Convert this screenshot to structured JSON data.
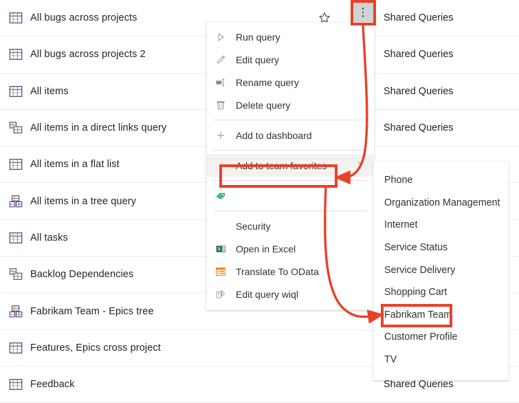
{
  "app": {
    "accent_red": "#e8412a",
    "highlight_bg": "#f3f2f1",
    "ellipsis_bg": "#d2d2d2"
  },
  "query_list": {
    "folder_label": "Shared Queries",
    "rows": [
      {
        "name": "All bugs across projects",
        "icon": "flat-query-icon",
        "folder": "Shared Queries",
        "has_star": true,
        "has_ellipsis": true
      },
      {
        "name": "All bugs across projects 2",
        "icon": "flat-query-icon",
        "folder": "Shared Queries",
        "has_star": false,
        "has_ellipsis": false
      },
      {
        "name": "All items",
        "icon": "flat-query-icon",
        "folder": "Shared Queries",
        "has_star": false,
        "has_ellipsis": false
      },
      {
        "name": "All items in a direct links query",
        "icon": "direct-links-query-icon",
        "folder": "Shared Queries",
        "has_star": false,
        "has_ellipsis": false
      },
      {
        "name": "All items in a flat list",
        "icon": "flat-query-icon",
        "folder": "",
        "has_star": false,
        "has_ellipsis": false
      },
      {
        "name": "All items in a tree query",
        "icon": "tree-query-icon",
        "folder": "",
        "has_star": false,
        "has_ellipsis": false
      },
      {
        "name": "All tasks",
        "icon": "flat-query-icon",
        "folder": "",
        "has_star": false,
        "has_ellipsis": false
      },
      {
        "name": "Backlog Dependencies",
        "icon": "direct-links-query-icon",
        "folder": "",
        "has_star": false,
        "has_ellipsis": false
      },
      {
        "name": "Fabrikam Team - Epics tree",
        "icon": "tree-query-icon",
        "folder": "",
        "has_star": false,
        "has_ellipsis": false
      },
      {
        "name": "Features, Epics cross project",
        "icon": "flat-query-icon",
        "folder": "",
        "has_star": false,
        "has_ellipsis": false
      },
      {
        "name": "Feedback",
        "icon": "flat-query-icon",
        "folder": "Shared Queries",
        "has_star": false,
        "has_ellipsis": false
      }
    ]
  },
  "context_menu": {
    "items": [
      {
        "label": "Run query",
        "icon": "play-icon",
        "type": "item"
      },
      {
        "label": "Edit query",
        "icon": "pencil-icon",
        "type": "item"
      },
      {
        "label": "Rename query",
        "icon": "rename-icon",
        "type": "item"
      },
      {
        "label": "Delete query",
        "icon": "trash-icon",
        "type": "item"
      },
      {
        "label": "",
        "icon": "",
        "type": "separator"
      },
      {
        "label": "Add to dashboard",
        "icon": "plus-icon",
        "type": "item"
      },
      {
        "label": "",
        "icon": "",
        "type": "separator"
      },
      {
        "label": "Add to team favorites",
        "icon": "",
        "type": "submenu",
        "highlighted": true
      },
      {
        "label": "",
        "icon": "",
        "type": "separator"
      },
      {
        "label": "",
        "icon": "tag-icon",
        "type": "item"
      },
      {
        "label": "",
        "icon": "",
        "type": "separator"
      },
      {
        "label": "Security",
        "icon": "",
        "type": "item"
      },
      {
        "label": "Open in Excel",
        "icon": "excel-icon",
        "type": "item"
      },
      {
        "label": "Translate To OData",
        "icon": "odata-icon",
        "type": "item"
      },
      {
        "label": "Edit query wiql",
        "icon": "wiql-icon",
        "type": "item"
      }
    ]
  },
  "submenu": {
    "items": [
      {
        "label": "Phone"
      },
      {
        "label": "Organization Management"
      },
      {
        "label": "Internet"
      },
      {
        "label": "Service Status"
      },
      {
        "label": "Service Delivery"
      },
      {
        "label": "Shopping Cart"
      },
      {
        "label": "Fabrikam Team",
        "highlighted": true
      },
      {
        "label": "Customer Profile"
      },
      {
        "label": "TV"
      }
    ]
  },
  "annotations": {
    "boxes": [
      {
        "name": "ellipsis-highlight-box",
        "target": "more-actions-button"
      },
      {
        "name": "add-to-team-favorites-box",
        "target": "Add to team favorites"
      },
      {
        "name": "fabrikam-team-box",
        "target": "Fabrikam Team"
      }
    ],
    "arrows": [
      {
        "name": "arrow-ellipsis-to-favorites",
        "from": "more-actions-button",
        "to": "Add to team favorites"
      },
      {
        "name": "arrow-favorites-to-fabrikam",
        "from": "Add to team favorites",
        "to": "Fabrikam Team"
      }
    ]
  }
}
